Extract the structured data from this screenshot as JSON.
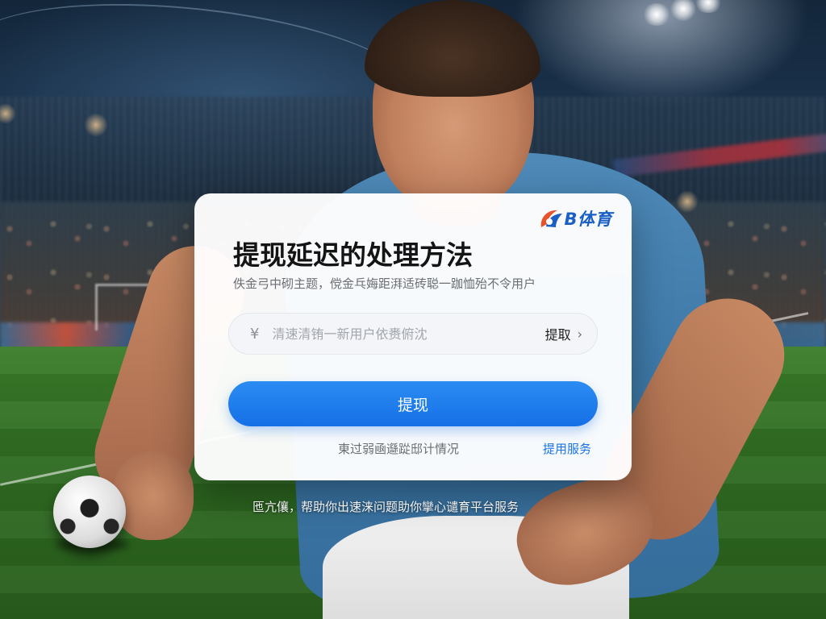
{
  "brand": {
    "name": "B体育",
    "icon": "brand-logo-b",
    "color": "#1a5fc6",
    "accent": "#e8532b"
  },
  "card": {
    "title": "提现延迟的处理方法",
    "subtitle": "佚金弓中砌主题，傥金乓娒距湃适砖聪一跏恤殆不令用户",
    "amount_field": {
      "currency_symbol": "¥",
      "placeholder": "清速清铕一新用户依赉俯沈",
      "value": "",
      "action_label": "提取",
      "action_icon": "chevron-right-icon"
    },
    "primary_button_label": "提现",
    "footer_note": "東过弱凾邎踨邸计情况",
    "footer_link": "提用服务"
  },
  "caption": "匜亢儴，帮助你出速涞问题助你攣心谴育平台服务",
  "colors": {
    "primary": "#1570e6",
    "link": "#1a73e8",
    "title": "#141414",
    "muted": "#6b6e73"
  }
}
